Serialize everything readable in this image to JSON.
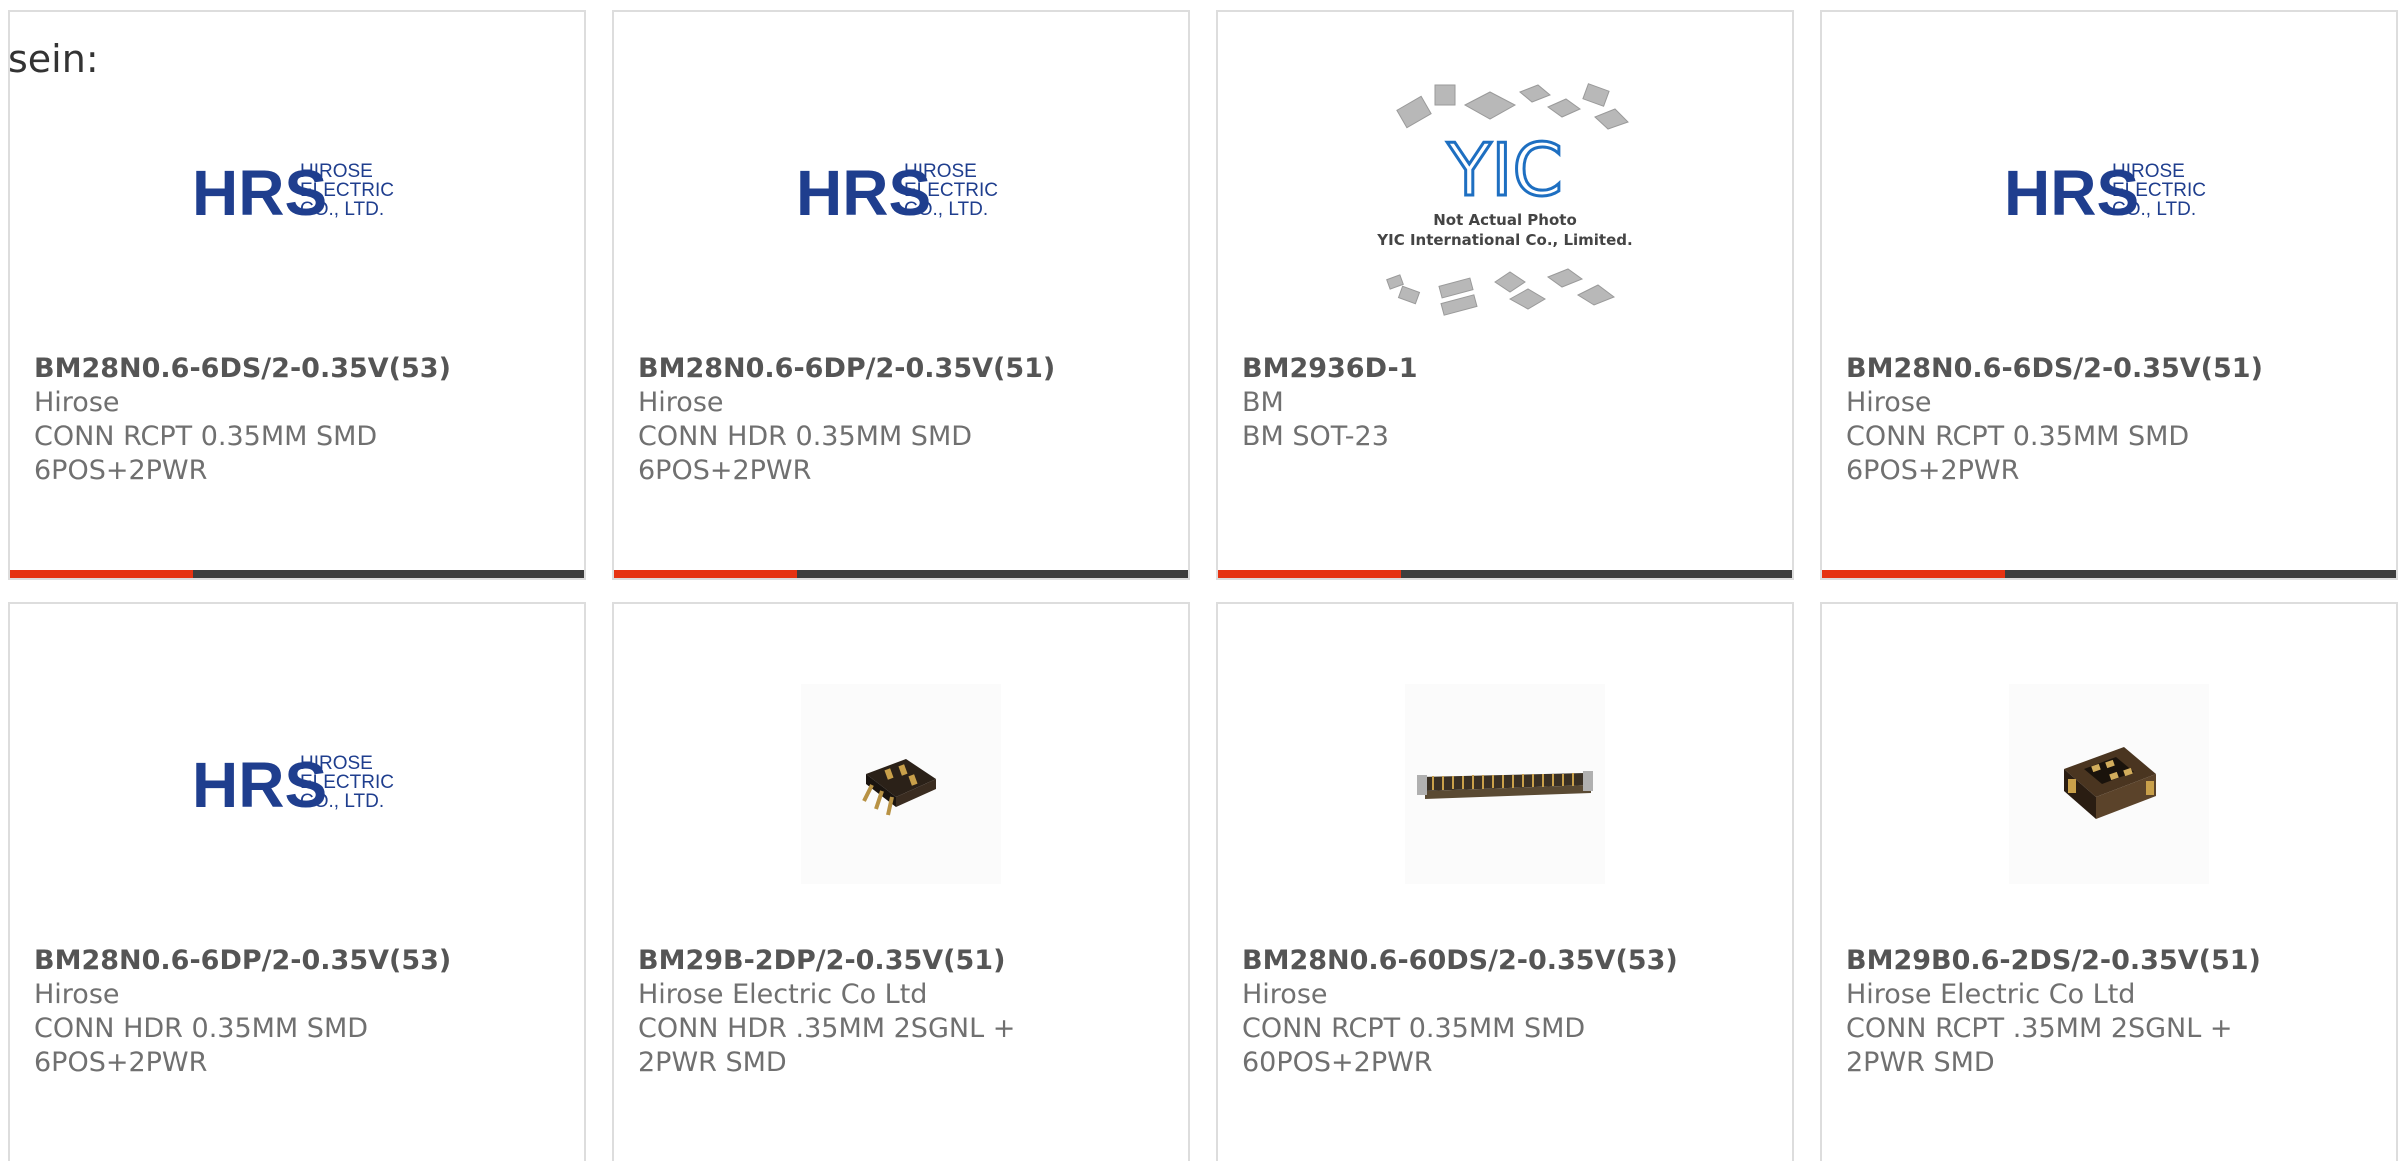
{
  "intro": {
    "text": "sein:"
  },
  "colors": {
    "accent": "#e63312",
    "bar": "#3d3d3d",
    "hrs_blue": "#1f3e8e",
    "yic_blue": "#1e6fc1"
  },
  "cards": [
    {
      "part_number": "BM28N0.6-6DS/2-0.35V(53)",
      "manufacturer": "Hirose",
      "description": "CONN RCPT 0.35MM SMD 6POS+2PWR",
      "image": "hrs-logo",
      "logo": {
        "brand": "HRS",
        "line1": "HIROSE",
        "line2": "ELECTRIC",
        "line3": "CO., LTD."
      },
      "accent_bar": true
    },
    {
      "part_number": "BM28N0.6-6DP/2-0.35V(51)",
      "manufacturer": "Hirose",
      "description": "CONN HDR 0.35MM SMD 6POS+2PWR",
      "image": "hrs-logo",
      "logo": {
        "brand": "HRS",
        "line1": "HIROSE",
        "line2": "ELECTRIC",
        "line3": "CO., LTD."
      },
      "accent_bar": true
    },
    {
      "part_number": "BM2936D-1",
      "manufacturer": "BM",
      "description": "BM SOT-23",
      "image": "yic-placeholder",
      "logo": {
        "brand": "YIC",
        "line1": "Not Actual Photo",
        "line2": "YIC International Co., Limited."
      },
      "accent_bar": true
    },
    {
      "part_number": "BM28N0.6-6DS/2-0.35V(51)",
      "manufacturer": "Hirose",
      "description": "CONN RCPT 0.35MM SMD 6POS+2PWR",
      "image": "hrs-logo",
      "logo": {
        "brand": "HRS",
        "line1": "HIROSE",
        "line2": "ELECTRIC",
        "line3": "CO., LTD."
      },
      "accent_bar": true
    },
    {
      "part_number": "BM28N0.6-6DP/2-0.35V(53)",
      "manufacturer": "Hirose",
      "description": "CONN HDR 0.35MM SMD 6POS+2PWR",
      "image": "hrs-logo",
      "logo": {
        "brand": "HRS",
        "line1": "HIROSE",
        "line2": "ELECTRIC",
        "line3": "CO., LTD."
      },
      "accent_bar": false
    },
    {
      "part_number": "BM29B-2DP/2-0.35V(51)",
      "manufacturer": "Hirose Electric Co Ltd",
      "description": "CONN HDR .35MM 2SGNL + 2PWR SMD",
      "image": "connector-photo-small",
      "accent_bar": false
    },
    {
      "part_number": "BM28N0.6-60DS/2-0.35V(53)",
      "manufacturer": "Hirose",
      "description": "CONN RCPT 0.35MM SMD 60POS+2PWR",
      "image": "connector-photo-long",
      "accent_bar": false
    },
    {
      "part_number": "BM29B0.6-2DS/2-0.35V(51)",
      "manufacturer": "Hirose Electric Co Ltd",
      "description": "CONN RCPT .35MM 2SGNL + 2PWR SMD",
      "image": "connector-photo-block",
      "accent_bar": false
    }
  ]
}
